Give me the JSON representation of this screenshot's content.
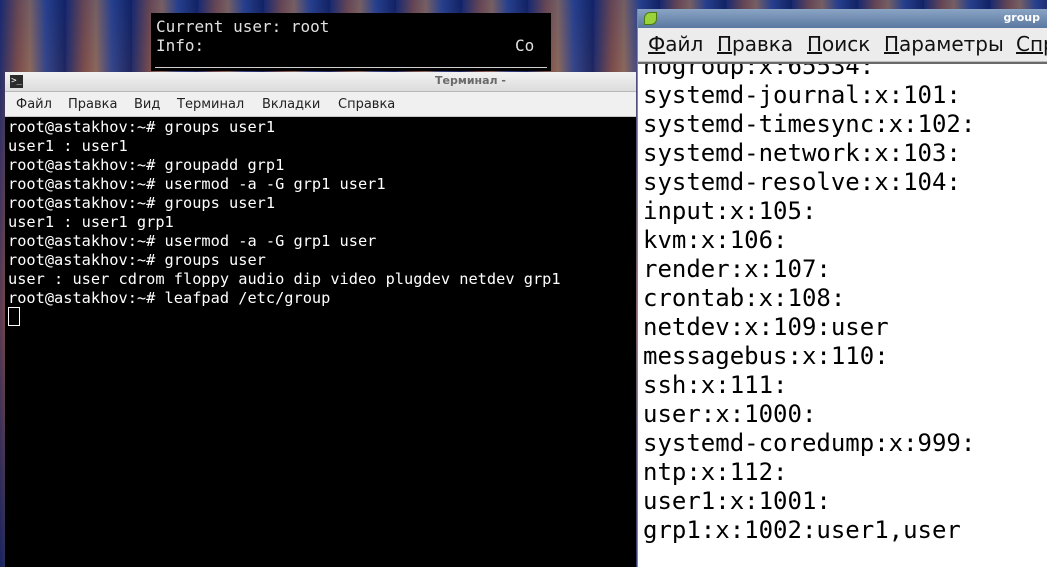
{
  "conky": {
    "line1": "Current user: root",
    "line2": "Info:",
    "extra": "Co"
  },
  "terminal": {
    "title": "Терминал -",
    "menu": [
      "Файл",
      "Правка",
      "Вид",
      "Терминал",
      "Вкладки",
      "Справка"
    ],
    "lines": [
      "root@astakhov:~# groups user1",
      "user1 : user1",
      "root@astakhov:~# groupadd grp1",
      "root@astakhov:~# usermod -a -G grp1 user1",
      "root@astakhov:~# groups user1",
      "user1 : user1 grp1",
      "root@astakhov:~# usermod -a -G grp1 user",
      "root@astakhov:~# groups user",
      "user : user cdrom floppy audio dip video plugdev netdev grp1",
      "root@astakhov:~# leafpad /etc/group"
    ]
  },
  "editor": {
    "title": "group",
    "menu": [
      {
        "acc": "Ф",
        "rest": "айл"
      },
      {
        "acc": "П",
        "rest": "равка"
      },
      {
        "acc": "П",
        "rest": "оиск"
      },
      {
        "acc": "П",
        "rest": "араметры"
      },
      {
        "acc": "Сп",
        "rest": "р"
      }
    ],
    "lines": [
      "nogroup:x:65534:",
      "systemd-journal:x:101:",
      "systemd-timesync:x:102:",
      "systemd-network:x:103:",
      "systemd-resolve:x:104:",
      "input:x:105:",
      "kvm:x:106:",
      "render:x:107:",
      "crontab:x:108:",
      "netdev:x:109:user",
      "messagebus:x:110:",
      "ssh:x:111:",
      "user:x:1000:",
      "systemd-coredump:x:999:",
      "ntp:x:112:",
      "user1:x:1001:",
      "grp1:x:1002:user1,user"
    ]
  }
}
